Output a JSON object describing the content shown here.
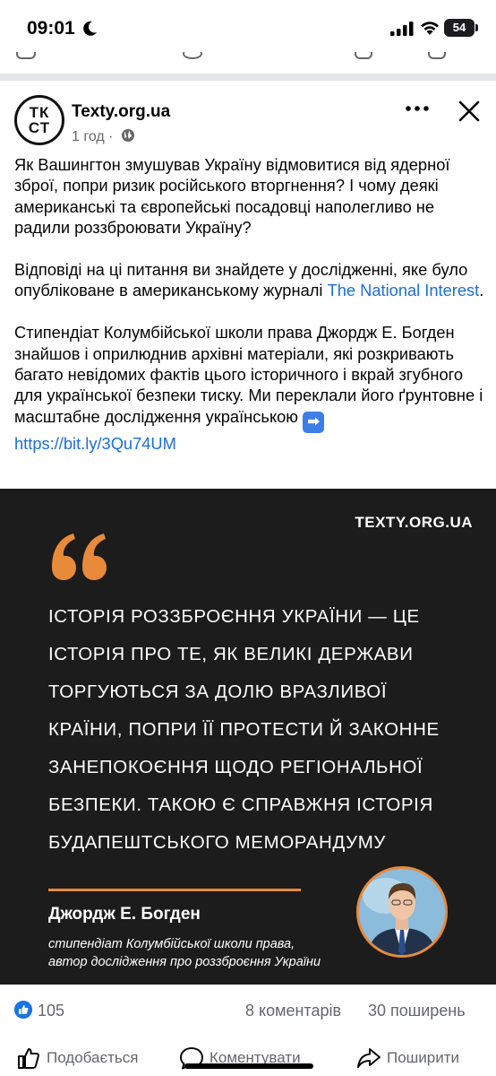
{
  "status_bar": {
    "time": "09:01",
    "battery": "54",
    "icons": [
      "moon-icon",
      "signal-icon",
      "wifi-icon",
      "battery-icon"
    ]
  },
  "post": {
    "page_name": "Texty.org.ua",
    "logo_text": [
      "ТК",
      "СТ"
    ],
    "time_ago": "1 год ·",
    "privacy_icon": "globe-icon",
    "paragraph1": "Як Вашингтон змушував Україну відмовитися від ядерної зброї, попри ризик російського вторгнення? І чому деякі американські та європейські посадовці наполегливо не радили роззброювати Україну?",
    "paragraph2_text": "Відповіді на ці питання ви знайдете у дослідженні, яке було опубліковане в американському журналі ",
    "paragraph2_link": "The National Interest",
    "paragraph2_end": ".",
    "paragraph3_text": "Стипендіат Колумбійської школи права Джордж Е. Богден знайшов і оприлюднив архівні матеріали, які розкривають багато невідомих фактів цього історичного і вкрай згубного для української безпеки тиску. Ми переклали його ґрунтовне і масштабне дослідження українською ",
    "paragraph3_arrow": "➡",
    "paragraph3_link": "https://bit.ly/3Qu74UM"
  },
  "card": {
    "brand": "TEXTY.ORG.UA",
    "quote_lines": [
      "Історія роззброєння України — це",
      "історія про те, як великі держави",
      "торгуються за долю вразливої",
      "країни, попри її протести й законне",
      "занепокоєння щодо регіональної",
      "безпеки. Такою є справжня історія",
      "Будапештського меморандуму"
    ],
    "author_name": "Джордж Е. Богден",
    "author_desc_line1": "стипендіат Колумбійської школи права,",
    "author_desc_line2": "автор дослідження про роззброєння України",
    "accent_color": "#e88a3a",
    "background_color": "#1c1c1c"
  },
  "reactions": {
    "likes": "105",
    "comments": "8 коментарів",
    "shares": "30 поширень"
  },
  "actions": {
    "like": "Подобається",
    "comment": "Коментувати",
    "share": "Поширити"
  },
  "colors": {
    "link": "#1b6fd6",
    "like_blue": "#1b74e4",
    "secondary_text": "#65676b"
  }
}
